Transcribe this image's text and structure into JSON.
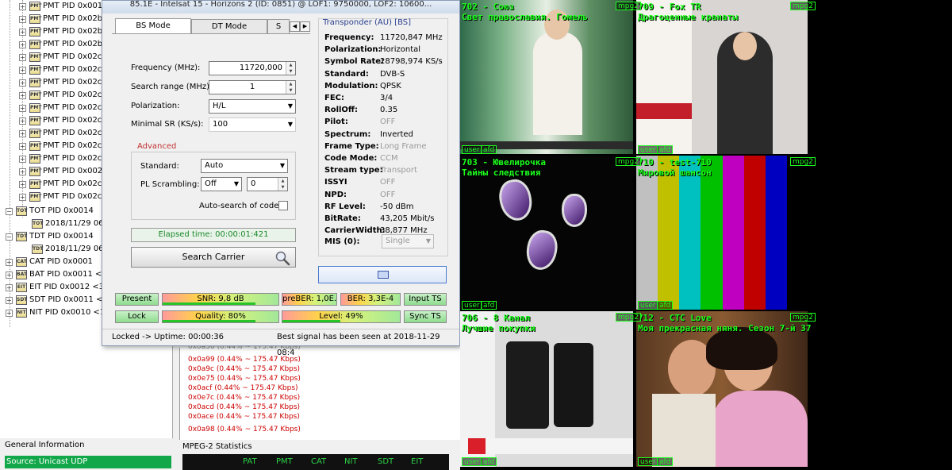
{
  "tree": {
    "pmt_rows": [
      "PMT PID 0x001",
      "PMT PID 0x02b",
      "PMT PID 0x02b",
      "PMT PID 0x02b",
      "PMT PID 0x02c",
      "PMT PID 0x02c",
      "PMT PID 0x02c",
      "PMT PID 0x02c",
      "PMT PID 0x02c",
      "PMT PID 0x02c",
      "PMT PID 0x02c",
      "PMT PID 0x02c",
      "PMT PID 0x02c",
      "PMT PID 0x002",
      "PMT PID 0x02c",
      "PMT PID 0x02c"
    ],
    "tot": "TOT PID 0x0014",
    "tot_time": "2018/11/29 06:4",
    "tdt": "TDT PID 0x0014",
    "tdt_time": "2018/11/29 06:4",
    "cat": "CAT PID 0x0001",
    "bat": "BAT PID 0x0011 <1",
    "eit": "EIT PID 0x0012 <34",
    "sdt": "SDT PID 0x0011 <1",
    "nit": "NIT PID 0x0010 <1E"
  },
  "general": {
    "title": "General Information",
    "source": "Source: Unicast UDP"
  },
  "bitrates": {
    "partial": "0x0a36 (0.44% ~ 175.47 Kbps)",
    "rows": [
      "0x0a99 (0.44% ~ 175.47 Kbps)",
      "0x0a9c (0.44% ~ 175.47 Kbps)",
      "0x0e75 (0.44% ~ 175.47 Kbps)",
      "0x0acf (0.44% ~ 175.47 Kbps)",
      "0x0e7c (0.44% ~ 175.47 Kbps)",
      "0x0acd (0.44% ~ 175.47 Kbps)",
      "0x0ace (0.44% ~ 175.47 Kbps)",
      "0x0a98 (0.44% ~ 175.47 Kbps)"
    ]
  },
  "mpeg": {
    "title": "MPEG-2 Statistics",
    "cols": [
      "PAT",
      "PMT",
      "CAT",
      "NIT",
      "SDT",
      "EIT"
    ]
  },
  "dialog": {
    "title": "85.1E - Intelsat 15 - Horizons 2 (ID: 0851) @ LOF1: 9750000, LOF2: 10600...",
    "tabs": [
      "BS Mode",
      "DT Mode",
      "S"
    ],
    "frequency_label": "Frequency (MHz):",
    "frequency_value": "11720,000",
    "range_label": "Search range (MHz):",
    "range_value": "1",
    "pol_label": "Polarization:",
    "pol_value": "H/L",
    "minsr_label": "Minimal SR (KS/s):",
    "minsr_value": "100",
    "advanced_title": "Advanced",
    "standard_label": "Standard:",
    "standard_value": "Auto",
    "pls_label": "PL Scrambling:",
    "pls_value": "Off",
    "pls_code": "0",
    "autosearch_label": "Auto-search of code",
    "elapsed": "Elapsed time: 00:00:01:421",
    "search_button": "Search Carrier",
    "status_left": "Locked -> Uptime: 00:00:36",
    "status_right": "Best signal has been seen at 2018-11-29 08:4"
  },
  "transponder": {
    "title": "Transponder (AU) [BS]",
    "rows": [
      {
        "label": "Frequency:",
        "value": "11720,847 MHz"
      },
      {
        "label": "Polarization:",
        "value": "Horizontal"
      },
      {
        "label": "Symbol Rate:",
        "value": "28798,974 KS/s"
      },
      {
        "label": "Standard:",
        "value": "DVB-S"
      },
      {
        "label": "Modulation:",
        "value": "QPSK"
      },
      {
        "label": "FEC:",
        "value": "3/4"
      },
      {
        "label": "RollOff:",
        "value": "0.35"
      },
      {
        "label": "Pilot:",
        "value": "OFF"
      },
      {
        "label": "Spectrum:",
        "value": "Inverted"
      },
      {
        "label": "Frame Type:",
        "value": "Long Frame"
      },
      {
        "label": "Code Mode:",
        "value": "CCM"
      },
      {
        "label": "Stream type:",
        "value": "Transport"
      },
      {
        "label": "ISSYI",
        "value": "OFF"
      },
      {
        "label": "NPD:",
        "value": "OFF"
      },
      {
        "label": "RF Level:",
        "value": "-50 dBm"
      },
      {
        "label": "BitRate:",
        "value": "43,205 Mbit/s"
      },
      {
        "label": "CarrierWidth:",
        "value": "38,877 MHz"
      }
    ],
    "mis_label": "MIS (0):",
    "mis_value": "Single"
  },
  "indicators": {
    "present": "Present",
    "lock": "Lock",
    "snr": "SNR: 9,8 dB",
    "quality": "Quality: 80%",
    "preber": "preBER: 1,0E...",
    "level": "Level: 49%",
    "ber": "BER: 3,3E-4",
    "input_ts": "Input TS",
    "sync_ts": "Sync TS",
    "quality_level": 0.8,
    "level_level": 0.49
  },
  "video": {
    "tiles": [
      {
        "l1": "702 - Союз",
        "l2": "Свет православия. Гомель"
      },
      {
        "l1": "709 - Fox TR",
        "l2": "Драгоценные кранаты"
      },
      {
        "l1": "703 - Ювелирочка",
        "l2": "Тайны следствия"
      },
      {
        "l1": "710 - test-710",
        "l2": "Мировой шансон"
      },
      {
        "l1": "706 - 8 Канал",
        "l2": "Лучшие покупки"
      },
      {
        "l1": "712 - CTC Love",
        "l2": "Моя прекрасная няня. Сезон 7-й 37"
      }
    ],
    "badge_user": "user",
    "badge_afd": "afd",
    "badge_codec": "mpg2",
    "bars": [
      "#c0c0c0",
      "#c0c000",
      "#00c0c0",
      "#00c000",
      "#c000c0",
      "#c00000",
      "#0000c0"
    ]
  }
}
